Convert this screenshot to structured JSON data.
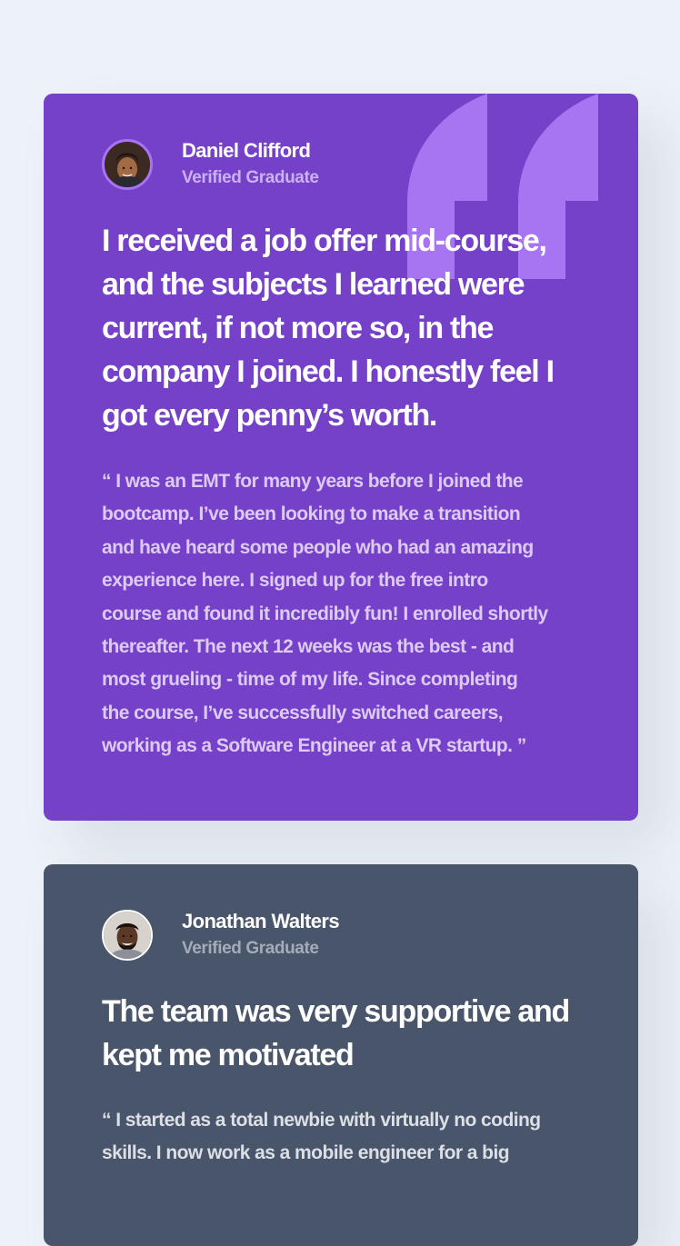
{
  "colors": {
    "page_background": "#edf2f8",
    "purple_card": "#7541c8",
    "slate_card": "#48556a",
    "quote_mark": "#a775f1",
    "purple_muted_text": "#ddcaf6",
    "slate_muted_text": "#dcdfe5"
  },
  "testimonials": [
    {
      "name": "Daniel Clifford",
      "role": "Verified Graduate",
      "avatar_icon": "avatar-daniel",
      "decoration_icon": "quotation-mark-icon",
      "headline": "I received a job offer mid-course, and the subjects I learned were current, if not more so, in the company I joined. I honestly feel I got every penny’s worth.",
      "body_lines": [
        "“ I was an EMT for many years before I joined the",
        "bootcamp. I’ve been looking to make a transition",
        "and have heard some people who had an amazing",
        "experience here. I signed up for the free intro",
        "course and found it incredibly fun! I enrolled shortly",
        "thereafter. The next 12 weeks was the best - and",
        "most grueling - time of my life. Since completing",
        "the course, I’ve successfully switched careers,",
        "working as a Software Engineer at a VR startup. ”"
      ]
    },
    {
      "name": "Jonathan Walters",
      "role": "Verified Graduate",
      "avatar_icon": "avatar-jonathan",
      "headline": "The team was very supportive and kept me motivated",
      "body_lines": [
        "“ I started as a total newbie with virtually no coding",
        "skills. I now work as a mobile engineer for a big"
      ]
    }
  ]
}
